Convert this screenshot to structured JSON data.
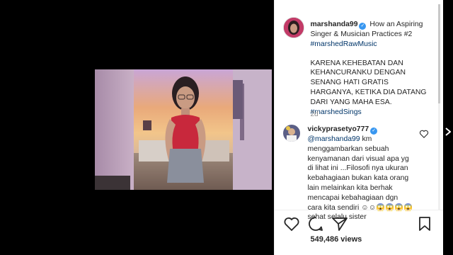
{
  "post": {
    "username": "marshanda99",
    "caption_title": "How an Aspiring Singer & Musician Practices #2",
    "caption_hashtag": "#marshedRawMusic",
    "caption_body": "KARENA KEHEBATAN DAN KEHANCURANKU DENGAN SENANG HATI GRATIS HARGANYA, KETIKA DIA DATANG DARI YANG MAHA ESA.",
    "caption_hashtag2": "#marshedSings",
    "timestamp": "2d",
    "views": "549,486 views"
  },
  "comment": {
    "username": "vickyprasetyo777",
    "mention": "@marshanda99",
    "text": " km menggambarkan sebuah kenyamanan dari visual apa yg di lihat ini ...Filosofi nya ukuran kebahagiaan bukan kata orang lain melainkan kita berhak mencapai kebahagiaan dgn cara kita sendiri",
    "emoji_line": "☺☺😱😱😱😱 sehat selalu sister"
  },
  "icons": {
    "verified": "verified-icon",
    "like": "heart-icon",
    "comment": "comment-icon",
    "share": "share-icon",
    "save": "bookmark-icon",
    "next": "chevron-right-icon"
  },
  "colors": {
    "verified": "#3897f0",
    "hashtag": "#003569",
    "text": "#262626",
    "muted": "#8e8e8e"
  }
}
